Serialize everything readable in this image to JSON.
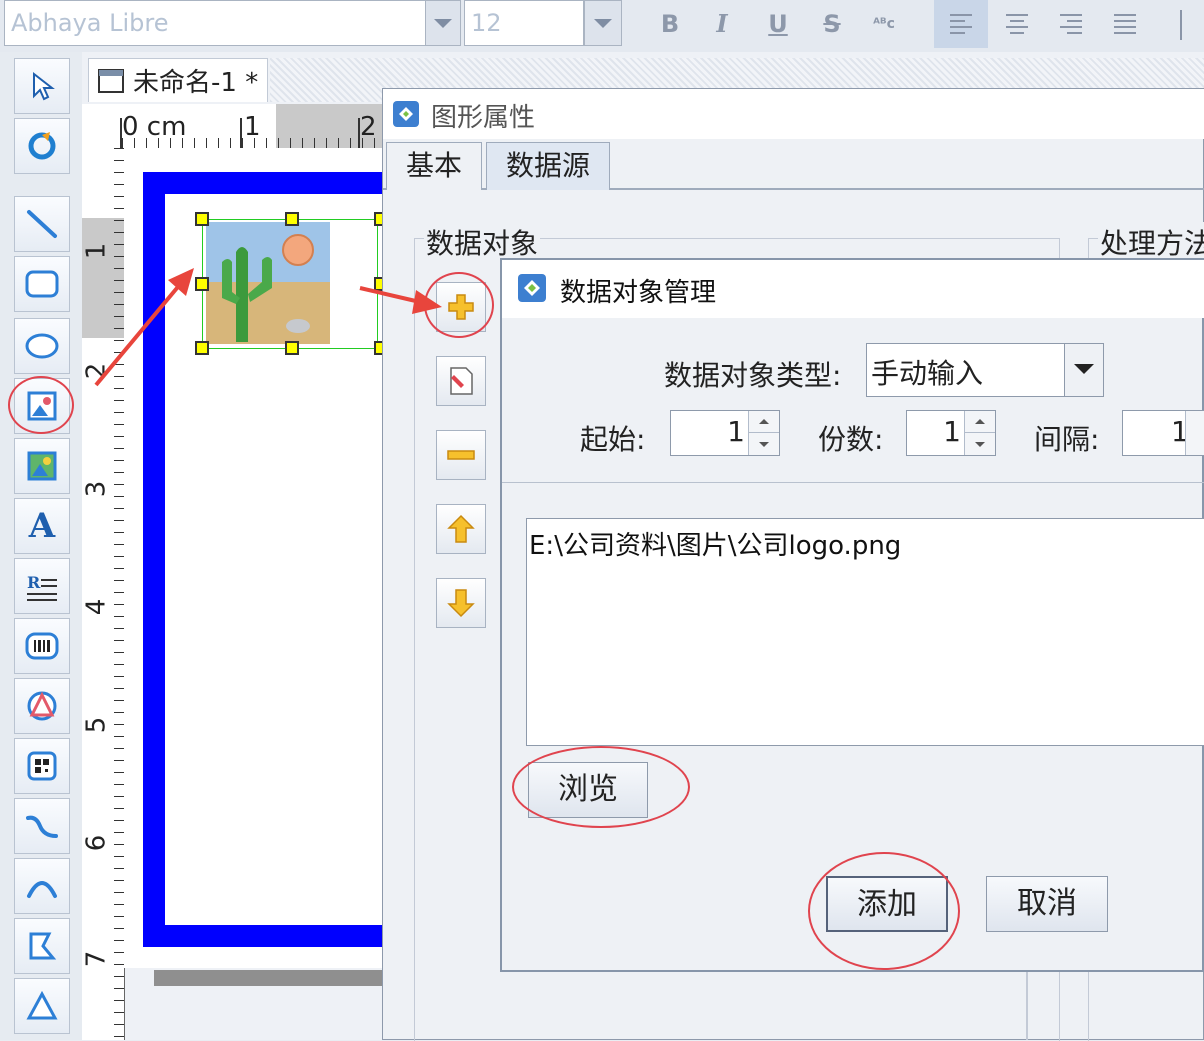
{
  "toolbar": {
    "font_name": "Abhaya Libre",
    "font_size": "12",
    "bold": "B",
    "italic": "I",
    "underline": "U",
    "strike": "S",
    "superscript": "ᴬᴮc"
  },
  "document": {
    "tab_title": "未命名-1 *",
    "ruler_unit": "0 cm",
    "ruler_h_numbers": [
      "1",
      "2"
    ],
    "ruler_v_numbers": [
      "1",
      "2",
      "3",
      "4",
      "5",
      "6",
      "7"
    ]
  },
  "graphic_dialog": {
    "title": "图形属性",
    "tabs": [
      {
        "label": "基本"
      },
      {
        "label": "数据源"
      }
    ],
    "data_object_group": "数据对象",
    "process_group": "处理方法"
  },
  "data_object_dialog": {
    "title": "数据对象管理",
    "type_label": "数据对象类型:",
    "type_value": "手动输入",
    "start_label": "起始:",
    "start_value": "1",
    "copies_label": "份数:",
    "copies_value": "1",
    "interval_label": "间隔:",
    "interval_value": "1",
    "path_text": "E:\\公司资料\\图片\\公司logo.png",
    "browse_label": "浏览",
    "add_label": "添加",
    "cancel_label": "取消"
  },
  "colors": {
    "highlight_circle": "#e0444e",
    "arrow": "#e8453c",
    "label_frame": "#0000ff",
    "handle": "#ffff00",
    "selection": "#22cc22"
  }
}
